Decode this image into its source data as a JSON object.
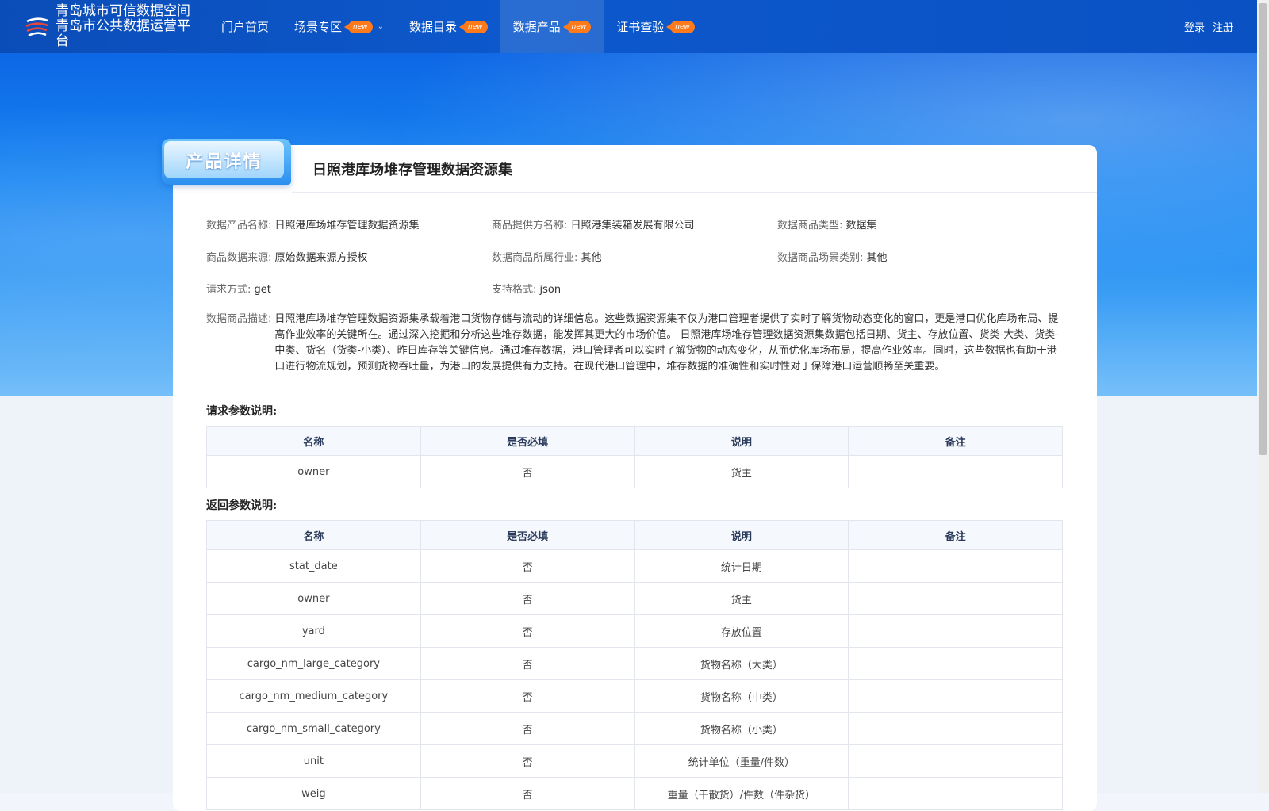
{
  "header": {
    "brand_line1": "青岛城市可信数据空间",
    "brand_line2": "青岛市公共数据运营平台",
    "nav": [
      {
        "label": "门户首页",
        "badge": ""
      },
      {
        "label": "场景专区",
        "badge": "new"
      },
      {
        "label": "数据目录",
        "badge": "new"
      },
      {
        "label": "数据产品",
        "badge": "new"
      },
      {
        "label": "证书查验",
        "badge": "new"
      }
    ],
    "login": "登录",
    "register": "注册"
  },
  "product": {
    "ribbon": "产品详情",
    "title": "日照港库场堆存管理数据资源集",
    "fields": {
      "name_label": "数据产品名称:",
      "name_value": "日照港库场堆存管理数据资源集",
      "provider_label": "商品提供方名称:",
      "provider_value": "日照港集装箱发展有限公司",
      "type_label": "数据商品类型:",
      "type_value": "数据集",
      "source_label": "商品数据来源:",
      "source_value": "原始数据来源方授权",
      "industry_label": "数据商品所属行业:",
      "industry_value": "其他",
      "scene_label": "数据商品场景类别:",
      "scene_value": "其他",
      "method_label": "请求方式:",
      "method_value": "get",
      "format_label": "支持格式:",
      "format_value": "json",
      "desc_label": "数据商品描述:",
      "desc_value": "日照港库场堆存管理数据资源集承载着港口货物存储与流动的详细信息。这些数据资源集不仅为港口管理者提供了实时了解货物动态变化的窗口，更是港口优化库场布局、提高作业效率的关键所在。通过深入挖掘和分析这些堆存数据，能发挥其更大的市场价值。 日照港库场堆存管理数据资源集数据包括日期、货主、存放位置、货类-大类、货类-中类、货名（货类-小类）、昨日库存等关键信息。通过堆存数据，港口管理者可以实时了解货物的动态变化，从而优化库场布局，提高作业效率。同时，这些数据也有助于港口进行物流规划，预测货物吞吐量，为港口的发展提供有力支持。在现代港口管理中，堆存数据的准确性和实时性对于保障港口运营顺畅至关重要。"
    }
  },
  "request_params": {
    "title": "请求参数说明:",
    "headers": [
      "名称",
      "是否必填",
      "说明",
      "备注"
    ],
    "rows": [
      [
        "owner",
        "否",
        "货主",
        ""
      ]
    ]
  },
  "response_params": {
    "title": "返回参数说明:",
    "headers": [
      "名称",
      "是否必填",
      "说明",
      "备注"
    ],
    "rows": [
      [
        "stat_date",
        "否",
        "统计日期",
        ""
      ],
      [
        "owner",
        "否",
        "货主",
        ""
      ],
      [
        "yard",
        "否",
        "存放位置",
        ""
      ],
      [
        "cargo_nm_large_category",
        "否",
        "货物名称（大类）",
        ""
      ],
      [
        "cargo_nm_medium_category",
        "否",
        "货物名称（中类）",
        ""
      ],
      [
        "cargo_nm_small_category",
        "否",
        "货物名称（小类）",
        ""
      ],
      [
        "unit",
        "否",
        "统计单位（重量/件数）",
        ""
      ],
      [
        "weig",
        "否",
        "重量（干散货）/件数（件杂货）",
        ""
      ]
    ]
  }
}
